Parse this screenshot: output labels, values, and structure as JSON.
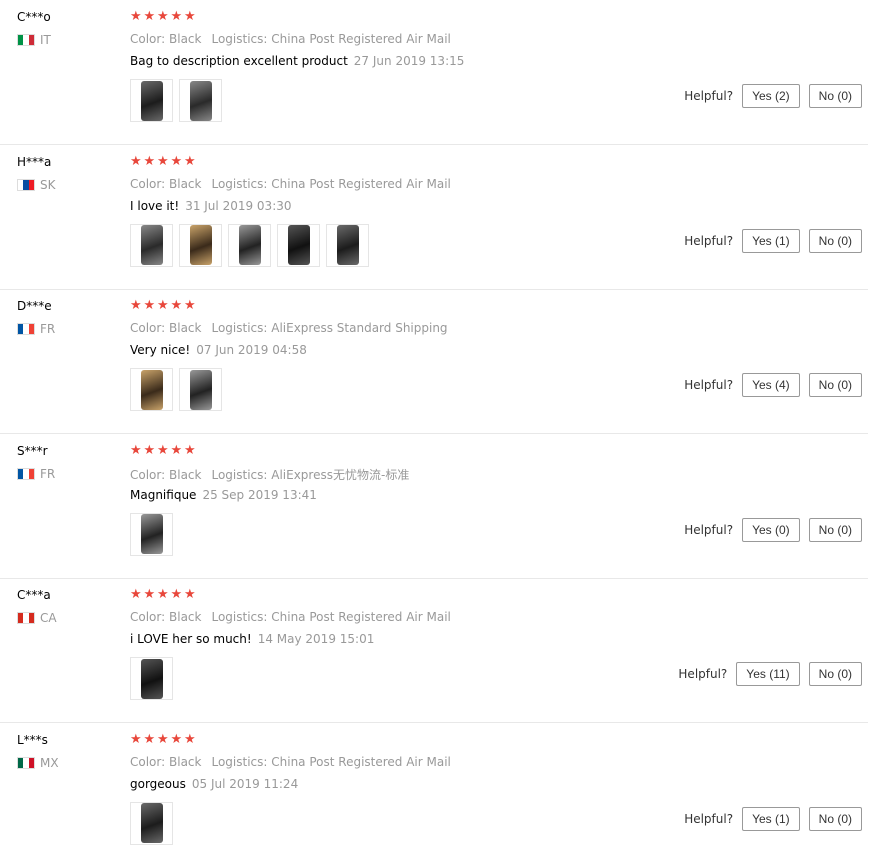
{
  "helpful_label": "Helpful?",
  "reviews": [
    {
      "user": "C***o",
      "country": "IT",
      "flag_colors": [
        "#009246",
        "#ffffff",
        "#ce2b37"
      ],
      "rating": 5,
      "color_label": "Color:",
      "color_value": "Black",
      "logistics_label": "Logistics:",
      "logistics_value": "China Post Registered Air Mail",
      "text": "Bag to description excellent product",
      "date": "27 Jun 2019 13:15",
      "photos": 2,
      "yes_label": "Yes (2)",
      "no_label": "No (0)"
    },
    {
      "user": "H***a",
      "country": "SK",
      "flag_colors": [
        "#ffffff",
        "#0b4ea2",
        "#ee1c25"
      ],
      "rating": 5,
      "color_label": "Color:",
      "color_value": "Black",
      "logistics_label": "Logistics:",
      "logistics_value": "China Post Registered Air Mail",
      "text": "I love it!",
      "date": "31 Jul 2019 03:30",
      "photos": 5,
      "yes_label": "Yes (1)",
      "no_label": "No (0)"
    },
    {
      "user": "D***e",
      "country": "FR",
      "flag_colors": [
        "#0055a4",
        "#ffffff",
        "#ef4135"
      ],
      "rating": 5,
      "color_label": "Color:",
      "color_value": "Black",
      "logistics_label": "Logistics:",
      "logistics_value": "AliExpress Standard Shipping",
      "text": "Very nice!",
      "date": "07 Jun 2019 04:58",
      "photos": 2,
      "yes_label": "Yes (4)",
      "no_label": "No (0)"
    },
    {
      "user": "S***r",
      "country": "FR",
      "flag_colors": [
        "#0055a4",
        "#ffffff",
        "#ef4135"
      ],
      "rating": 5,
      "color_label": "Color:",
      "color_value": "Black",
      "logistics_label": "Logistics:",
      "logistics_value": "AliExpress无忧物流-标准",
      "text": "Magnifique",
      "date": "25 Sep 2019 13:41",
      "photos": 1,
      "yes_label": "Yes (0)",
      "no_label": "No (0)"
    },
    {
      "user": "C***a",
      "country": "CA",
      "flag_colors": [
        "#d52b1e",
        "#ffffff",
        "#d52b1e"
      ],
      "rating": 5,
      "color_label": "Color:",
      "color_value": "Black",
      "logistics_label": "Logistics:",
      "logistics_value": "China Post Registered Air Mail",
      "text": "i LOVE her so much!",
      "date": "14 May 2019 15:01",
      "photos": 1,
      "yes_label": "Yes (11)",
      "no_label": "No (0)"
    },
    {
      "user": "L***s",
      "country": "MX",
      "flag_colors": [
        "#006847",
        "#ffffff",
        "#ce1126"
      ],
      "rating": 5,
      "color_label": "Color:",
      "color_value": "Black",
      "logistics_label": "Logistics:",
      "logistics_value": "China Post Registered Air Mail",
      "text": "gorgeous",
      "date": "05 Jul 2019 11:24",
      "photos": 1,
      "yes_label": "Yes (1)",
      "no_label": "No (0)"
    }
  ]
}
